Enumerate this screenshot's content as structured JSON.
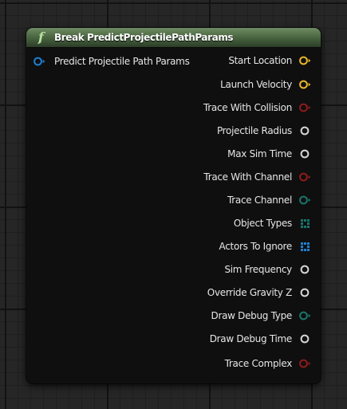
{
  "node": {
    "icon": "function-icon",
    "icon_glyph": "f",
    "title": "Break PredictProjectilePathParams"
  },
  "colors": {
    "struct": "#1d7fd0",
    "vector": "#e7b52a",
    "bool": "#8e1b1b",
    "float": "#d5d5d5",
    "byte": "#19756a",
    "object": "#1d7fd0"
  },
  "inputs": [
    {
      "label": "Predict Projectile Path Params",
      "type": "struct",
      "shape": "circle-arrow"
    }
  ],
  "outputs": [
    {
      "label": "Start Location",
      "type": "vector",
      "shape": "circle-arrow"
    },
    {
      "label": "Launch Velocity",
      "type": "vector",
      "shape": "circle-arrow"
    },
    {
      "label": "Trace With Collision",
      "type": "bool",
      "shape": "circle-arrow"
    },
    {
      "label": "Projectile Radius",
      "type": "float",
      "shape": "circle"
    },
    {
      "label": "Max Sim Time",
      "type": "float",
      "shape": "circle"
    },
    {
      "label": "Trace With Channel",
      "type": "bool",
      "shape": "circle-arrow"
    },
    {
      "label": "Trace Channel",
      "type": "byte",
      "shape": "circle-arrow"
    },
    {
      "label": "Object Types",
      "type": "byte",
      "shape": "array"
    },
    {
      "label": "Actors To Ignore",
      "type": "object",
      "shape": "array"
    },
    {
      "label": "Sim Frequency",
      "type": "float",
      "shape": "circle"
    },
    {
      "label": "Override Gravity Z",
      "type": "float",
      "shape": "circle"
    },
    {
      "label": "Draw Debug Type",
      "type": "byte",
      "shape": "circle-arrow"
    },
    {
      "label": "Draw Debug Time",
      "type": "float",
      "shape": "circle"
    },
    {
      "label": "Trace Complex",
      "type": "bool",
      "shape": "circle-arrow"
    }
  ]
}
